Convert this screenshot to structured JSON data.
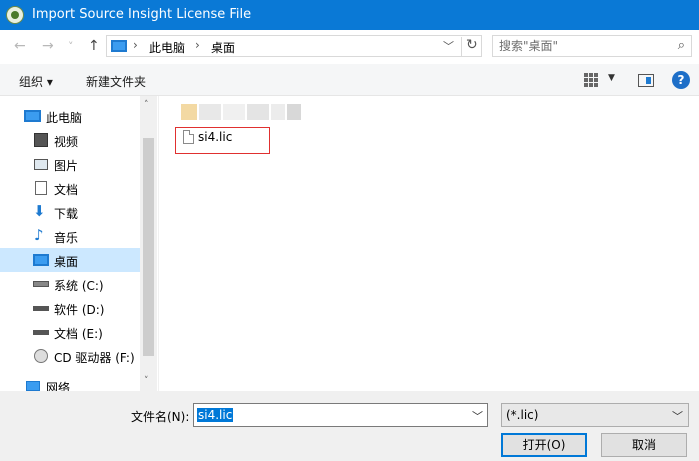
{
  "window": {
    "title": "Import Source Insight License File"
  },
  "nav": {
    "back": "←",
    "forward": "→",
    "history": "˅",
    "up": "↑",
    "breadcrumb": [
      "此电脑",
      "桌面"
    ],
    "dropdown": "﹀",
    "refresh": "↻"
  },
  "search": {
    "placeholder": "搜索\"桌面\"",
    "icon": "search-icon"
  },
  "toolbar": {
    "organize": "组织 ▾",
    "new_folder": "新建文件夹",
    "help": "?"
  },
  "sidebar": {
    "items": [
      {
        "label": "此电脑",
        "icon": "computer-icon"
      },
      {
        "label": "视频",
        "icon": "video-folder-icon"
      },
      {
        "label": "图片",
        "icon": "pictures-folder-icon"
      },
      {
        "label": "文档",
        "icon": "documents-folder-icon"
      },
      {
        "label": "下载",
        "icon": "download-icon"
      },
      {
        "label": "音乐",
        "icon": "music-icon"
      },
      {
        "label": "桌面",
        "icon": "desktop-icon",
        "selected": true
      },
      {
        "label": "系统 (C:)",
        "icon": "system-drive-icon"
      },
      {
        "label": "软件 (D:)",
        "icon": "drive-icon"
      },
      {
        "label": "文档 (E:)",
        "icon": "drive-icon"
      },
      {
        "label": "CD 驱动器 (F:)",
        "icon": "cd-drive-icon"
      },
      {
        "label": "网络",
        "icon": "network-icon"
      }
    ],
    "scroll_up": "˄",
    "scroll_down": "˅"
  },
  "files": [
    {
      "name": "si4.lic",
      "icon": "file-icon"
    }
  ],
  "bottom": {
    "filename_label": "文件名(N):",
    "filename_value": "si4.lic",
    "filetype_value": "(*.lic)",
    "open_label": "打开(O)",
    "cancel_label": "取消",
    "dropdown": "﹀"
  },
  "colors": {
    "titlebar": "#0a79d6",
    "selection": "#cce8ff",
    "accent": "#0078d7",
    "highlight_box": "#e0302f"
  }
}
